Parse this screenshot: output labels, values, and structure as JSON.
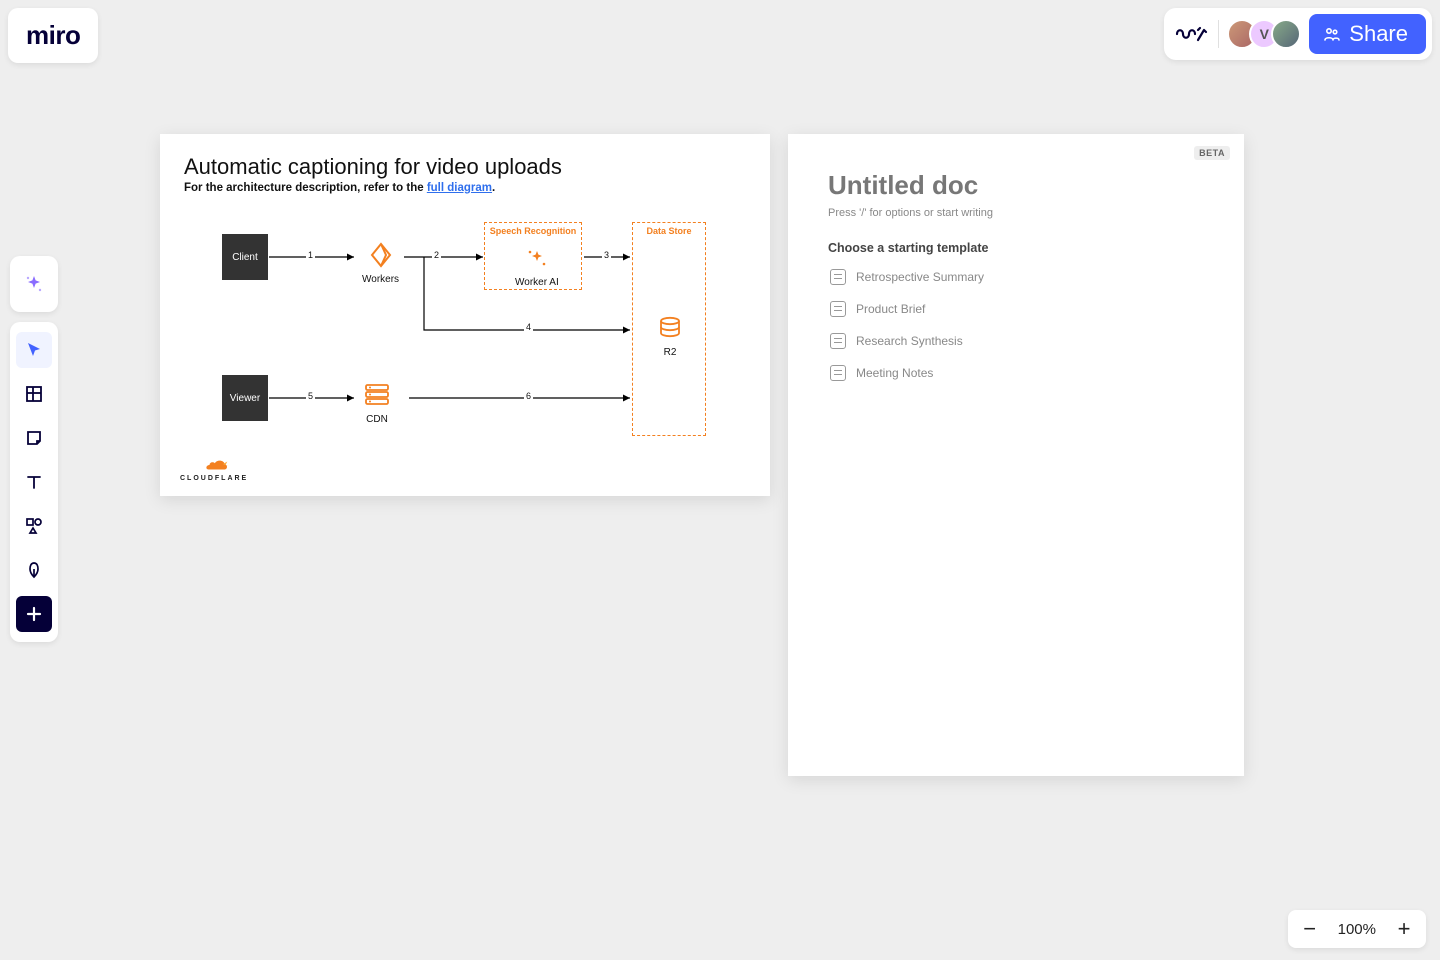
{
  "logo": "miro",
  "header": {
    "avatar2_initial": "V",
    "share_label": "Share"
  },
  "toolbar": {
    "tools": [
      "ai",
      "select",
      "frame",
      "sticky",
      "text",
      "shapes",
      "pen",
      "add"
    ]
  },
  "diagram": {
    "title": "Automatic captioning for video uploads",
    "subtitle_prefix": "For the architecture description, refer to the ",
    "subtitle_link": "full diagram",
    "subtitle_suffix": ".",
    "nodes": {
      "client": "Client",
      "workers": "Workers",
      "speech_label": "Speech Recognition",
      "worker_ai": "Worker AI",
      "datastore_label": "Data Store",
      "r2": "R2",
      "viewer": "Viewer",
      "cdn": "CDN"
    },
    "edges": {
      "e1": "1",
      "e2": "2",
      "e3": "3",
      "e4": "4",
      "e5": "5",
      "e6": "6"
    },
    "footer_brand": "CLOUDFLARE"
  },
  "doc": {
    "beta": "BETA",
    "title": "Untitled doc",
    "hint": "Press '/' for options or start writing",
    "choose_label": "Choose a starting template",
    "templates": [
      "Retrospective Summary",
      "Product Brief",
      "Research Synthesis",
      "Meeting Notes"
    ]
  },
  "zoom": {
    "value": "100%"
  }
}
